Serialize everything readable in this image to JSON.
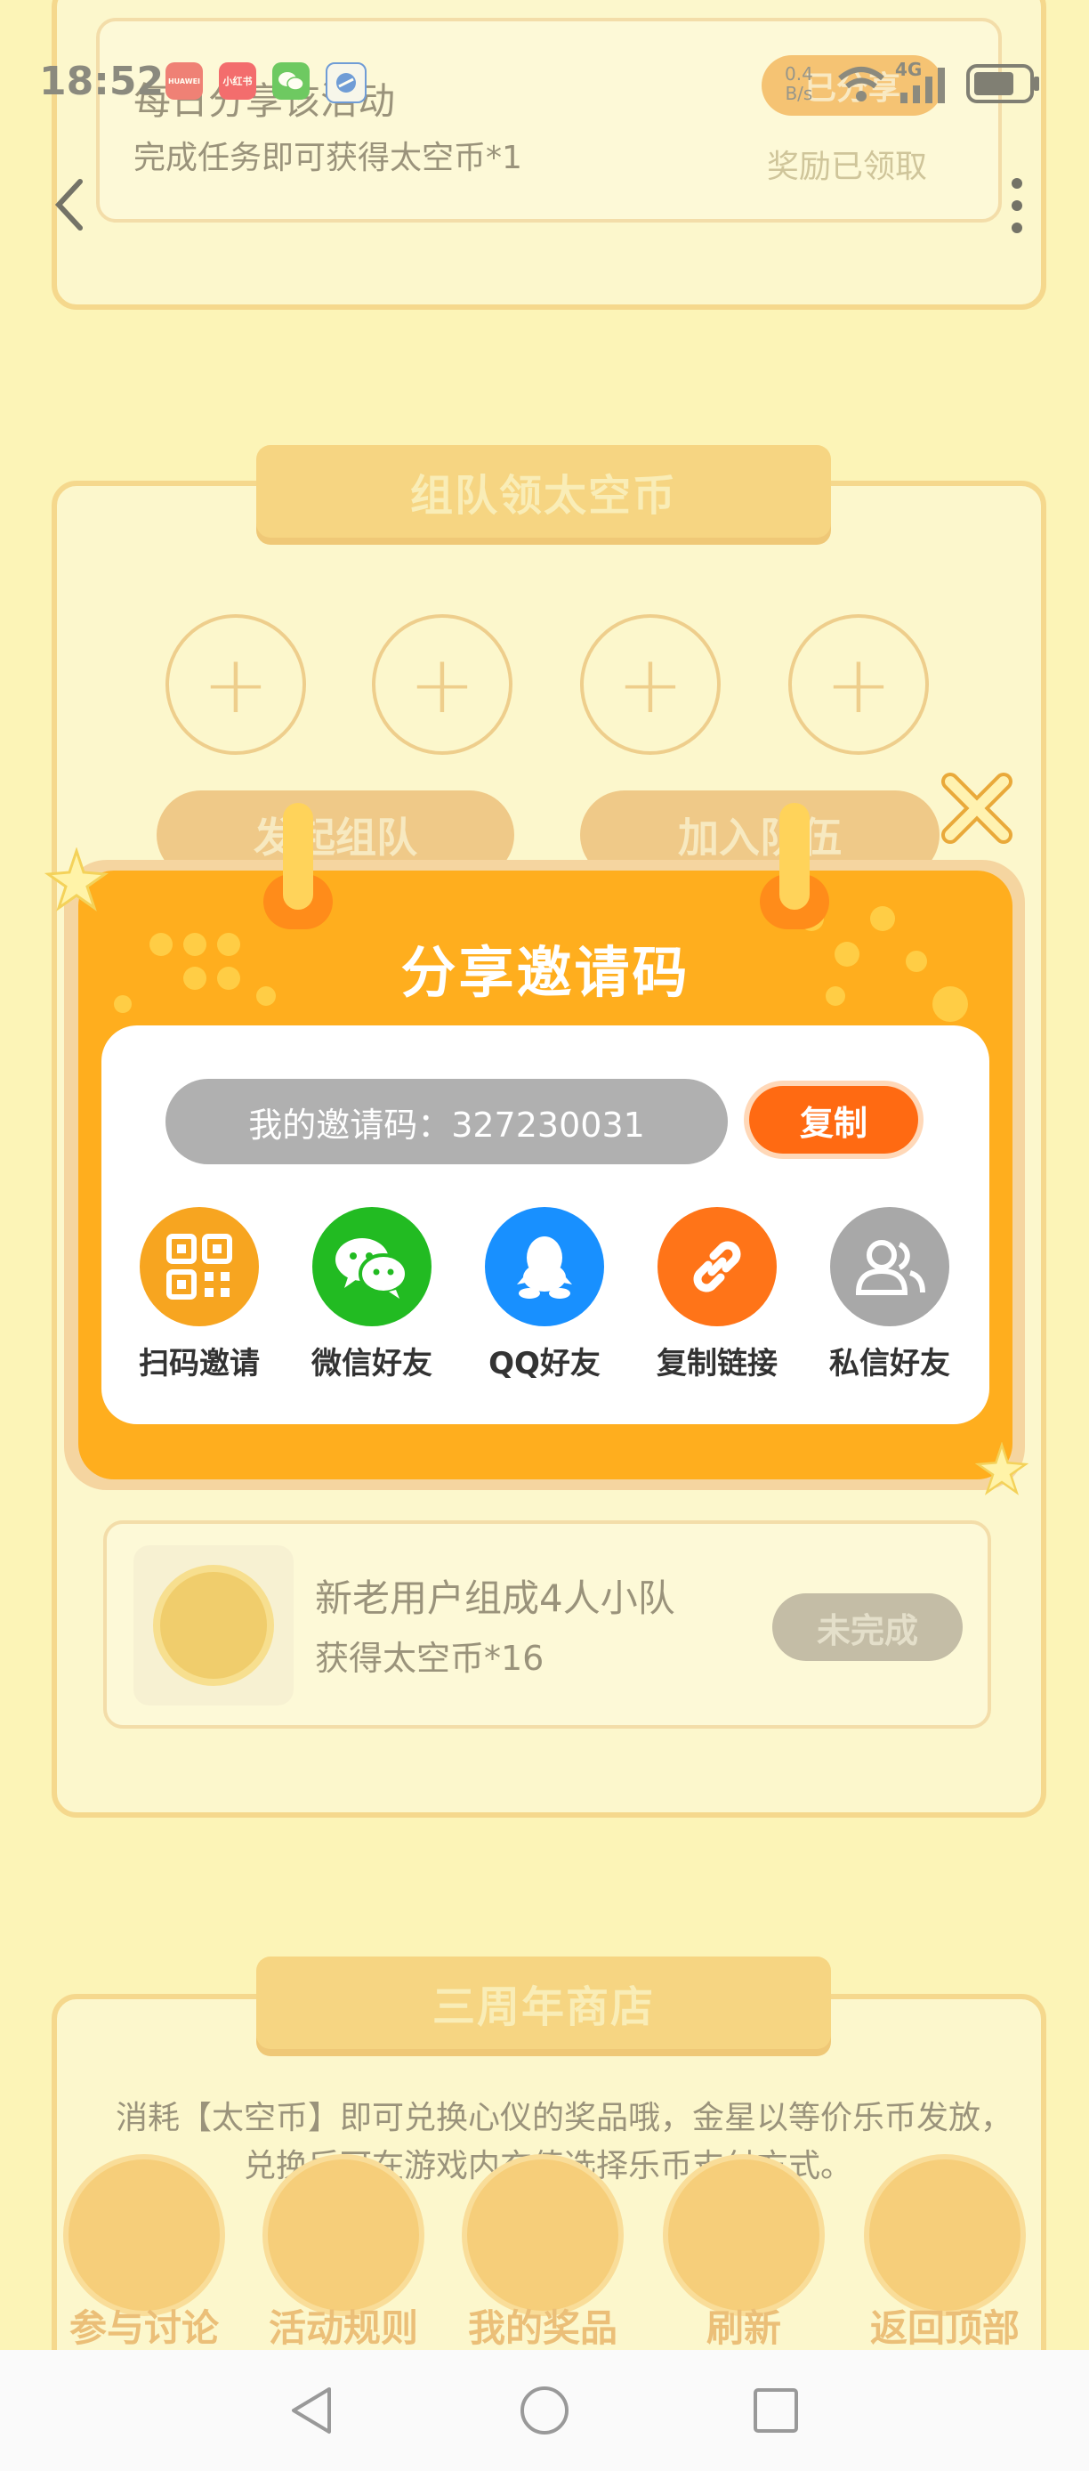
{
  "status_bar": {
    "time": "18:52",
    "app_icons": [
      "HUAWEI",
      "小红书",
      "WeChat",
      "Browser"
    ],
    "network": "4G",
    "speed_text": "B/s"
  },
  "background": {
    "daily_share": {
      "title": "每日分享该活动",
      "subtitle": "完成任务即可获得太空币*1",
      "button_label": "已分享",
      "reward_status": "奖励已领取"
    },
    "team": {
      "title": "组队领太空币",
      "create_button": "发起组队",
      "join_button": "加入队伍",
      "task_title": "新老用户组成4人小队",
      "task_reward": "获得太空币*16",
      "task_status": "未完成"
    },
    "shop": {
      "title": "三周年商店",
      "desc_line1": "消耗【太空币】即可兑换心仪的奖品哦，金星以等价乐币发放，",
      "desc_line2": "兑换后可在游戏内充值选择乐币支付方式。"
    }
  },
  "modal": {
    "title": "分享邀请码",
    "invite_code_label": "我的邀请码：327230031",
    "copy_button": "复制",
    "share_options": [
      {
        "label": "扫码邀请",
        "icon": "qr-code-icon",
        "color": "#f7a520"
      },
      {
        "label": "微信好友",
        "icon": "wechat-icon",
        "color": "#22bb22"
      },
      {
        "label": "QQ好友",
        "icon": "qq-icon",
        "color": "#1890ff"
      },
      {
        "label": "复制链接",
        "icon": "link-icon",
        "color": "#ff7418"
      },
      {
        "label": "私信好友",
        "icon": "friends-icon",
        "color": "#a8a8a8"
      }
    ]
  },
  "bottom_nav": {
    "items": [
      "参与讨论",
      "活动规则",
      "我的奖品",
      "刷新",
      "返回顶部"
    ]
  },
  "colors": {
    "modal_orange": "#ffae1e",
    "copy_button": "#ff6a12",
    "code_pill": "#b0b0b0"
  }
}
